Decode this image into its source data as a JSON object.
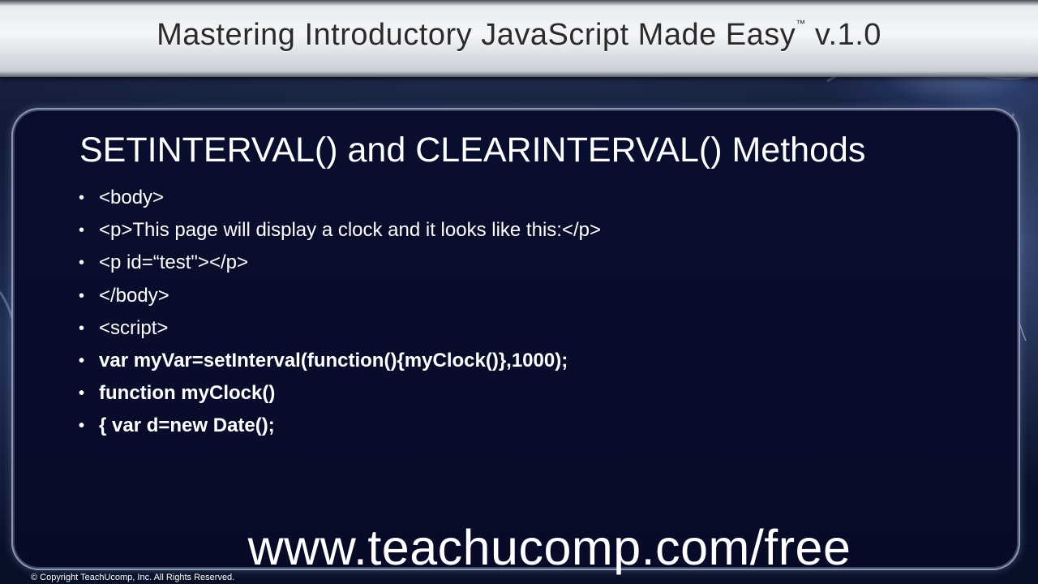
{
  "header": {
    "title": "Mastering Introductory JavaScript Made Easy",
    "trademark": "™",
    "version": "v.1.0"
  },
  "slide": {
    "heading": "SETINTERVAL() and CLEARINTERVAL() Methods",
    "bullet_symbol": "•",
    "bullets": [
      {
        "text": "<body>",
        "bold": false
      },
      {
        "text": "<p>This page will display a clock and it looks like this:</p>",
        "bold": false
      },
      {
        "text": "<p id=“test\"></p>",
        "bold": false
      },
      {
        "text": "</body>",
        "bold": false
      },
      {
        "text": "<script>",
        "bold": false
      },
      {
        "text": "var myVar=setInterval(function(){myClock()},1000);",
        "bold": true
      },
      {
        "text": "function myClock()",
        "bold": true
      },
      {
        "text": "{ var d=new Date();",
        "bold": true
      }
    ]
  },
  "footer": {
    "website": "www.teachucomp.com/free",
    "copyright": "© Copyright TeachUcomp, Inc. All Rights Reserved."
  },
  "colors": {
    "background": "#050a1c",
    "panel": "#0a0e2e",
    "text": "#ffffff",
    "title_text": "#2b2b2b"
  }
}
